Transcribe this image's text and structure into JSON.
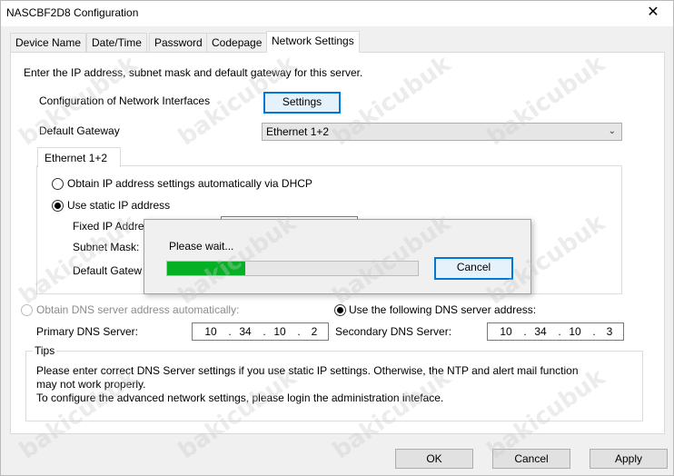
{
  "window": {
    "title": "NASCBF2D8 Configuration",
    "close_glyph": "✕"
  },
  "tabs": [
    {
      "label": "Device Name"
    },
    {
      "label": "Date/Time"
    },
    {
      "label": "Password"
    },
    {
      "label": "Codepage"
    },
    {
      "label": "Network Settings"
    }
  ],
  "panel": {
    "intro": "Enter the IP address, subnet mask and default gateway for this server.",
    "config_label": "Configuration of Network Interfaces",
    "settings_button": "Settings",
    "gateway_label": "Default Gateway",
    "gateway_value": "Ethernet 1+2",
    "subtab_label": "Ethernet 1+2",
    "dhcp_option": "Obtain IP address settings automatically via DHCP",
    "static_option": "Use static IP address",
    "fixed_ip_label": "Fixed IP Addre",
    "subnet_label": "Subnet Mask:",
    "default_gw_label": "Default Gatew",
    "dns_auto_option": "Obtain DNS server address automatically:",
    "dns_manual_option": "Use the following DNS server address:",
    "primary_dns_label": "Primary DNS Server:",
    "secondary_dns_label": "Secondary DNS Server:",
    "primary_dns": [
      "10",
      "34",
      "10",
      "2"
    ],
    "secondary_dns": [
      "10",
      "34",
      "10",
      "3"
    ],
    "tips_title": "Tips",
    "tips_line1": "Please enter correct DNS Server settings if you use static IP settings.  Otherwise, the NTP and alert mail function",
    "tips_line2": "may not work properly.",
    "tips_line3": "To configure the advanced network settings, please login the administration inteface."
  },
  "dialog": {
    "message": "Please wait...",
    "cancel_label": "Cancel",
    "progress": 0.31
  },
  "footer": {
    "ok_label": "OK",
    "cancel_label": "Cancel",
    "apply_label": "Apply"
  },
  "watermark": "bakicubuk",
  "colors": {
    "progress": "#06b025",
    "focus": "#0078d7"
  }
}
